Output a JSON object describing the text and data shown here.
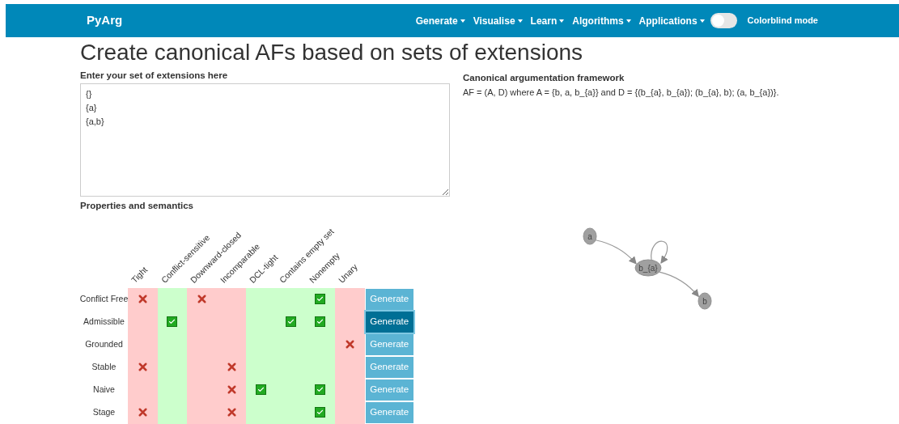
{
  "navbar": {
    "brand": "PyArg",
    "menus": [
      {
        "label": "Generate"
      },
      {
        "label": "Visualise"
      },
      {
        "label": "Learn"
      },
      {
        "label": "Algorithms"
      },
      {
        "label": "Applications"
      }
    ],
    "colorblind": {
      "label": "Colorblind mode",
      "on": false
    }
  },
  "title": "Create canonical AFs based on sets of extensions",
  "extensions": {
    "label": "Enter your set of extensions here",
    "value": "{}\n{a}\n{a,b}"
  },
  "properties": {
    "label": "Properties and semantics",
    "columns": [
      {
        "label": "Tight",
        "color": "#ffcccc"
      },
      {
        "label": "Conflict-sensitive",
        "color": "#ccffcc"
      },
      {
        "label": "Downward-closed",
        "color": "#ffcccc"
      },
      {
        "label": "Incomparable",
        "color": "#ffcccc"
      },
      {
        "label": "DCL-tight",
        "color": "#ccffcc"
      },
      {
        "label": "Contains empty set",
        "color": "#ccffcc"
      },
      {
        "label": "Nonempty",
        "color": "#ccffcc"
      },
      {
        "label": "Unary",
        "color": "#ffcccc"
      }
    ],
    "rows": [
      {
        "label": "Conflict Free",
        "cells": [
          {
            "kind": "cross"
          },
          {
            "kind": "empty"
          },
          {
            "kind": "cross"
          },
          {
            "kind": "empty"
          },
          {
            "kind": "empty"
          },
          {
            "kind": "empty"
          },
          {
            "kind": "check"
          },
          {
            "kind": "empty"
          }
        ],
        "button": "Generate",
        "selected": false
      },
      {
        "label": "Admissible",
        "cells": [
          {
            "kind": "empty"
          },
          {
            "kind": "check"
          },
          {
            "kind": "empty"
          },
          {
            "kind": "empty"
          },
          {
            "kind": "empty"
          },
          {
            "kind": "check"
          },
          {
            "kind": "check"
          },
          {
            "kind": "empty"
          }
        ],
        "button": "Generate",
        "selected": true
      },
      {
        "label": "Grounded",
        "cells": [
          {
            "kind": "empty"
          },
          {
            "kind": "empty"
          },
          {
            "kind": "empty"
          },
          {
            "kind": "empty"
          },
          {
            "kind": "empty"
          },
          {
            "kind": "empty"
          },
          {
            "kind": "empty"
          },
          {
            "kind": "cross"
          }
        ],
        "button": "Generate",
        "selected": false
      },
      {
        "label": "Stable",
        "cells": [
          {
            "kind": "cross"
          },
          {
            "kind": "empty"
          },
          {
            "kind": "empty"
          },
          {
            "kind": "cross"
          },
          {
            "kind": "empty"
          },
          {
            "kind": "empty"
          },
          {
            "kind": "empty"
          },
          {
            "kind": "empty"
          }
        ],
        "button": "Generate",
        "selected": false
      },
      {
        "label": "Naive",
        "cells": [
          {
            "kind": "empty"
          },
          {
            "kind": "empty"
          },
          {
            "kind": "empty"
          },
          {
            "kind": "cross"
          },
          {
            "kind": "check"
          },
          {
            "kind": "empty"
          },
          {
            "kind": "check"
          },
          {
            "kind": "empty"
          }
        ],
        "button": "Generate",
        "selected": false
      },
      {
        "label": "Stage",
        "cells": [
          {
            "kind": "cross"
          },
          {
            "kind": "empty"
          },
          {
            "kind": "empty"
          },
          {
            "kind": "cross"
          },
          {
            "kind": "empty"
          },
          {
            "kind": "empty"
          },
          {
            "kind": "check"
          },
          {
            "kind": "empty"
          }
        ],
        "button": "Generate",
        "selected": false
      }
    ]
  },
  "framework": {
    "label": "Canonical argumentation framework",
    "description": "AF = (A, D) where A = {b, a, b_{a}} and D = {(b_{a}, b_{a}); (b_{a}, b); (a, b_{a})}.",
    "nodes": [
      {
        "label": "a"
      },
      {
        "label": "b_{a}"
      },
      {
        "label": "b"
      }
    ]
  }
}
